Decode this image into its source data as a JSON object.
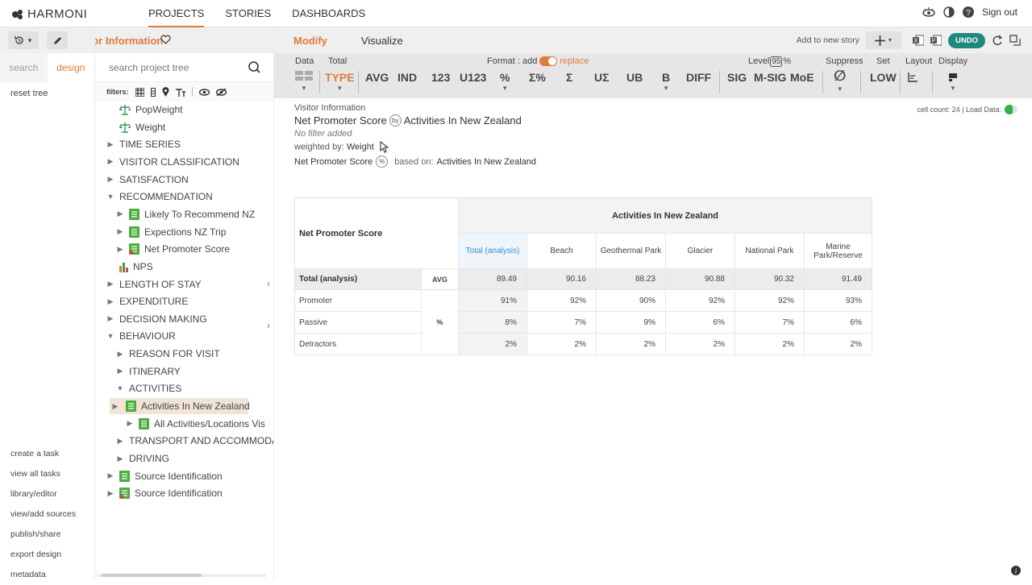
{
  "app": {
    "brand": "HARMONI",
    "accent": "#e07a3e",
    "teal": "#1e8a7e"
  },
  "nav": {
    "tabs": [
      "PROJECTS",
      "STORIES",
      "DASHBOARDS"
    ],
    "active": "PROJECTS",
    "sign_out": "Sign out"
  },
  "left": {
    "tabs": [
      "search",
      "design"
    ],
    "active_tab": "design",
    "reset_tree": "reset tree",
    "links": [
      "create a task",
      "view all tasks",
      "library/editor",
      "view/add sources",
      "publish/share",
      "export design",
      "metadata"
    ]
  },
  "project": {
    "name": "Visitor Information"
  },
  "tree": {
    "search_placeholder": "search project tree",
    "filters_label": "filters:",
    "nodes": [
      {
        "label": "PopWeight",
        "icon": "scale-icon"
      },
      {
        "label": "Weight",
        "icon": "scale-icon"
      },
      {
        "label": "TIME SERIES",
        "icon": "arrow-right"
      },
      {
        "label": "VISITOR CLASSIFICATION",
        "icon": "arrow-right"
      },
      {
        "label": "SATISFACTION",
        "icon": "arrow-right"
      },
      {
        "label": "RECOMMENDATION",
        "icon": "arrow-down"
      },
      {
        "label": "Likely To Recommend NZ",
        "icon": "green-table"
      },
      {
        "label": "Expections NZ Trip",
        "icon": "green-table"
      },
      {
        "label": "Net Promoter Score",
        "icon": "red-table"
      },
      {
        "label": "NPS",
        "icon": "numeric-icon"
      },
      {
        "label": "LENGTH OF STAY",
        "icon": "arrow-right"
      },
      {
        "label": "EXPENDITURE",
        "icon": "arrow-right"
      },
      {
        "label": "DECISION MAKING",
        "icon": "arrow-right"
      },
      {
        "label": "BEHAVIOUR",
        "icon": "arrow-down"
      },
      {
        "label": "REASON FOR VISIT",
        "icon": "arrow-right"
      },
      {
        "label": "ITINERARY",
        "icon": "arrow-right"
      },
      {
        "label": "ACTIVITIES",
        "icon": "arrow-down"
      },
      {
        "label": "Activities In New Zealand",
        "icon": "green-table"
      },
      {
        "label": "All Activities/Locations Vis",
        "icon": "green-table"
      },
      {
        "label": "TRANSPORT AND ACCOMMODA",
        "icon": "arrow-right"
      },
      {
        "label": "DRIVING",
        "icon": "arrow-right"
      },
      {
        "label": "Source Identification",
        "icon": "green-table"
      },
      {
        "label": "Source Identification",
        "icon": "red-table"
      }
    ]
  },
  "modbar": {
    "modify": "Modify",
    "visualize": "Visualize",
    "add_story": "Add to new story",
    "undo": "UNDO"
  },
  "toolbar": {
    "labels": {
      "data": "Data",
      "total": "Total",
      "format": "Format : add",
      "replace": "replace",
      "level": "Level",
      "level_val": "95",
      "pct": "%",
      "suppress": "Suppress",
      "set": "Set",
      "layout": "Layout",
      "display": "Display"
    },
    "items": [
      "TYPE",
      "AVG",
      "IND",
      "123",
      "U123",
      "%",
      "Σ%",
      "Σ",
      "UΣ",
      "UB",
      "B",
      "DIFF",
      "SIG",
      "M-SIG",
      "MoE",
      "∅",
      "LOW"
    ]
  },
  "report": {
    "project": "Visitor Information",
    "row_var": "Net Promoter Score",
    "by": "by",
    "col_var": "Activities In New Zealand",
    "filter": "No filter added",
    "weighted_label": "weighted by:",
    "weight": "Weight",
    "stat_row": "Net Promoter Score",
    "pct_badge": "%",
    "based_on_label": "based on:",
    "based_on": "Activities In New Zealand",
    "cell_count": "cell count: 24 | Load Data:"
  },
  "table": {
    "row_header": "Net Promoter Score",
    "col_group": "Activities In New Zealand",
    "columns": [
      "Total (analysis)",
      "Beach",
      "Geothermal Park",
      "Glacier",
      "National Park",
      "Marine Park/Reserve"
    ],
    "rows": [
      {
        "label": "Total (analysis)",
        "stat": "AVG",
        "values": [
          "89.49",
          "90.16",
          "88.23",
          "90.88",
          "90.32",
          "91.49"
        ]
      },
      {
        "label": "Promoter",
        "stat": "%",
        "values": [
          "91%",
          "92%",
          "90%",
          "92%",
          "92%",
          "93%"
        ]
      },
      {
        "label": "Passive",
        "stat": "",
        "values": [
          "8%",
          "7%",
          "9%",
          "6%",
          "7%",
          "6%"
        ]
      },
      {
        "label": "Detractors",
        "stat": "",
        "values": [
          "2%",
          "2%",
          "2%",
          "2%",
          "2%",
          "2%"
        ]
      }
    ]
  }
}
